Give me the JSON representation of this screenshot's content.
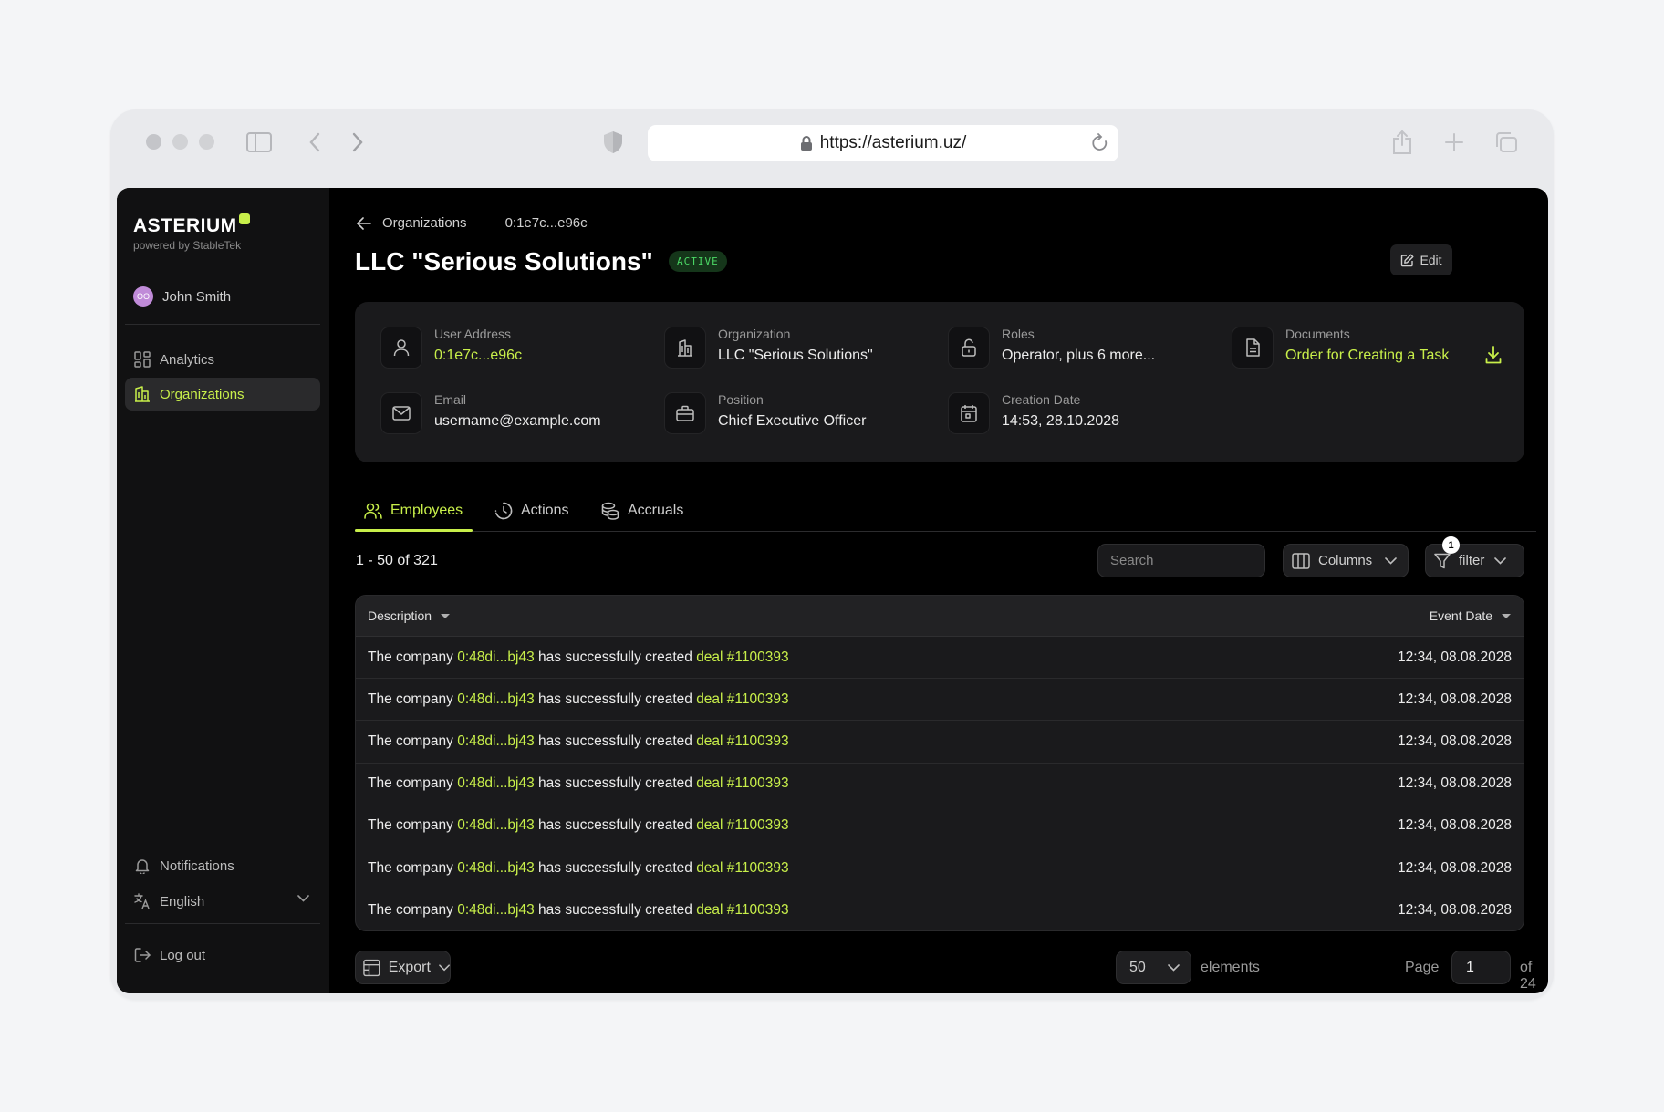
{
  "browser": {
    "url": "https://asterium.uz/",
    "colors": {
      "dot": "#c4c5c9",
      "accent": "#c8ef4a"
    }
  },
  "sidebar": {
    "brand": "ASTERIUM",
    "brand_sub": "powered by StableTek",
    "user": {
      "name": "John Smith",
      "initials": "OO"
    },
    "nav": [
      {
        "label": "Analytics",
        "icon": "grid-icon",
        "active": false
      },
      {
        "label": "Organizations",
        "icon": "building-icon",
        "active": true
      }
    ],
    "bottom": {
      "notifications": "Notifications",
      "language": "English",
      "logout": "Log out"
    }
  },
  "header": {
    "breadcrumb": [
      "Organizations",
      "0:1e7c...e96c"
    ],
    "title": "LLC \"Serious Solutions\"",
    "status": "ACTIVE",
    "edit": "Edit"
  },
  "info": {
    "user_address": {
      "label": "User Address",
      "value": "0:1e7c...e96c"
    },
    "organization": {
      "label": "Organization",
      "value": "LLC \"Serious Solutions\""
    },
    "roles": {
      "label": "Roles",
      "value": "Operator, plus 6 more..."
    },
    "documents": {
      "label": "Documents",
      "value": "Order for Creating a Task"
    },
    "email": {
      "label": "Email",
      "value": "username@example.com"
    },
    "position": {
      "label": "Position",
      "value": "Chief Executive Officer"
    },
    "creation_date": {
      "label": "Creation Date",
      "value": "14:53, 28.10.2028"
    }
  },
  "tabs": [
    {
      "label": "Employees",
      "active": true
    },
    {
      "label": "Actions",
      "active": false
    },
    {
      "label": "Accruals",
      "active": false
    }
  ],
  "toolbar": {
    "count": "1 - 50 of 321",
    "search_placeholder": "Search",
    "columns": "Columns",
    "filter": "filter",
    "filter_count": "1"
  },
  "table": {
    "columns": [
      "Description",
      "Event Date"
    ],
    "rows": [
      {
        "prefix": "The company",
        "company": "0:48di...bj43",
        "middle": "has successfully created",
        "deal": "deal #1100393",
        "date": "12:34, 08.08.2028"
      },
      {
        "prefix": "The company",
        "company": "0:48di...bj43",
        "middle": "has successfully created",
        "deal": "deal #1100393",
        "date": "12:34, 08.08.2028"
      },
      {
        "prefix": "The company",
        "company": "0:48di...bj43",
        "middle": "has successfully created",
        "deal": "deal #1100393",
        "date": "12:34, 08.08.2028"
      },
      {
        "prefix": "The company",
        "company": "0:48di...bj43",
        "middle": "has successfully created",
        "deal": "deal #1100393",
        "date": "12:34, 08.08.2028"
      },
      {
        "prefix": "The company",
        "company": "0:48di...bj43",
        "middle": "has successfully created",
        "deal": "deal #1100393",
        "date": "12:34, 08.08.2028"
      },
      {
        "prefix": "The company",
        "company": "0:48di...bj43",
        "middle": "has successfully created",
        "deal": "deal #1100393",
        "date": "12:34, 08.08.2028"
      },
      {
        "prefix": "The company",
        "company": "0:48di...bj43",
        "middle": "has successfully created",
        "deal": "deal #1100393",
        "date": "12:34, 08.08.2028"
      }
    ]
  },
  "footer": {
    "export": "Export",
    "page_size": "50",
    "elements": "elements",
    "page_label": "Page",
    "page": "1",
    "of_pages": "of 24"
  }
}
